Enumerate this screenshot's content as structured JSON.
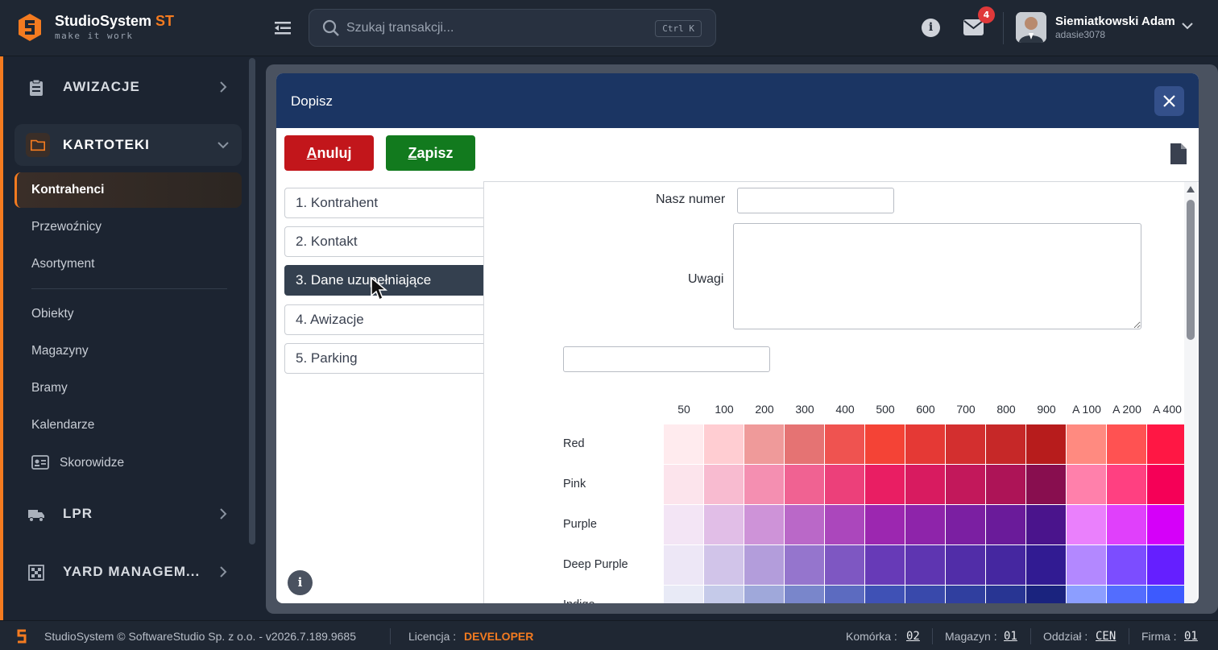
{
  "app": {
    "brand_name": "StudioSystem",
    "brand_suffix": "ST",
    "brand_tagline": "make it work",
    "accent_color": "#f47b20"
  },
  "search": {
    "placeholder": "Szukaj transakcji...",
    "shortcut": "Ctrl K"
  },
  "header": {
    "notifications_count": "4",
    "user_name": "Siemiatkowski Adam",
    "user_login": "adasie3078"
  },
  "sidebar": {
    "groups": [
      {
        "label": "AWIZACJE",
        "icon": "clipboard-icon"
      },
      {
        "label": "KARTOTEKI",
        "icon": "folder-icon"
      },
      {
        "label": "LPR",
        "icon": "truck-icon"
      },
      {
        "label": "YARD MANAGEM...",
        "icon": "grid-icon"
      }
    ],
    "items": [
      {
        "label": "Kontrahenci"
      },
      {
        "label": "Przewoźnicy"
      },
      {
        "label": "Asortyment"
      },
      {
        "label": "Obiekty"
      },
      {
        "label": "Magazyny"
      },
      {
        "label": "Bramy"
      },
      {
        "label": "Kalendarze"
      },
      {
        "label": "Skorowidze"
      }
    ]
  },
  "modal": {
    "title": "Dopisz",
    "cancel_first": "A",
    "cancel_rest": "nuluj",
    "save_first": "Z",
    "save_rest": "apisz",
    "tabs": [
      {
        "label": "1. Kontrahent"
      },
      {
        "label": "2. Kontakt"
      },
      {
        "label": "3. Dane uzupełniające"
      },
      {
        "label": "4. Awizacje"
      },
      {
        "label": "5. Parking"
      }
    ],
    "form": {
      "our_number_label": "Nasz numer",
      "our_number_value": "",
      "notes_label": "Uwagi",
      "notes_value": "",
      "extra_value": ""
    },
    "palette": {
      "shades": [
        "50",
        "100",
        "200",
        "300",
        "400",
        "500",
        "600",
        "700",
        "800",
        "900",
        "A 100",
        "A 200",
        "A 400"
      ],
      "rows": [
        {
          "name": "Red",
          "colors": [
            "#ffebee",
            "#ffcdd2",
            "#ef9a9a",
            "#e57373",
            "#ef5350",
            "#f44336",
            "#e53935",
            "#d32f2f",
            "#c62828",
            "#b71c1c",
            "#ff8a80",
            "#ff5252",
            "#ff1744"
          ]
        },
        {
          "name": "Pink",
          "colors": [
            "#fce4ec",
            "#f8bbd0",
            "#f48fb1",
            "#f06292",
            "#ec407a",
            "#e91e63",
            "#d81b60",
            "#c2185b",
            "#ad1457",
            "#880e4f",
            "#ff80ab",
            "#ff4081",
            "#f50057"
          ]
        },
        {
          "name": "Purple",
          "colors": [
            "#f3e5f5",
            "#e1bee7",
            "#ce93d8",
            "#ba68c8",
            "#ab47bc",
            "#9c27b0",
            "#8e24aa",
            "#7b1fa2",
            "#6a1b9a",
            "#4a148c",
            "#ea80fc",
            "#e040fb",
            "#d500f9"
          ]
        },
        {
          "name": "Deep Purple",
          "colors": [
            "#ede7f6",
            "#d1c4e9",
            "#b39ddb",
            "#9575cd",
            "#7e57c2",
            "#673ab7",
            "#5e35b1",
            "#512da8",
            "#4527a0",
            "#311b92",
            "#b388ff",
            "#7c4dff",
            "#651fff"
          ]
        },
        {
          "name": "Indigo",
          "colors": [
            "#e8eaf6",
            "#c5cae9",
            "#9fa8da",
            "#7986cb",
            "#5c6bc0",
            "#3f51b5",
            "#3949ab",
            "#303f9f",
            "#283593",
            "#1a237e",
            "#8c9eff",
            "#536dfe",
            "#3d5afe"
          ]
        }
      ]
    }
  },
  "footer": {
    "copyright": "StudioSystem © SoftwareStudio Sp. z o.o. - v2026.7.189.9685",
    "license_label": "Licencja :",
    "license_value": "DEVELOPER",
    "cell_label": "Komórka :",
    "cell_value": "02",
    "warehouse_label": "Magazyn :",
    "warehouse_value": "01",
    "branch_label": "Oddział :",
    "branch_value": "CEN",
    "company_label": "Firma :",
    "company_value": "01"
  }
}
